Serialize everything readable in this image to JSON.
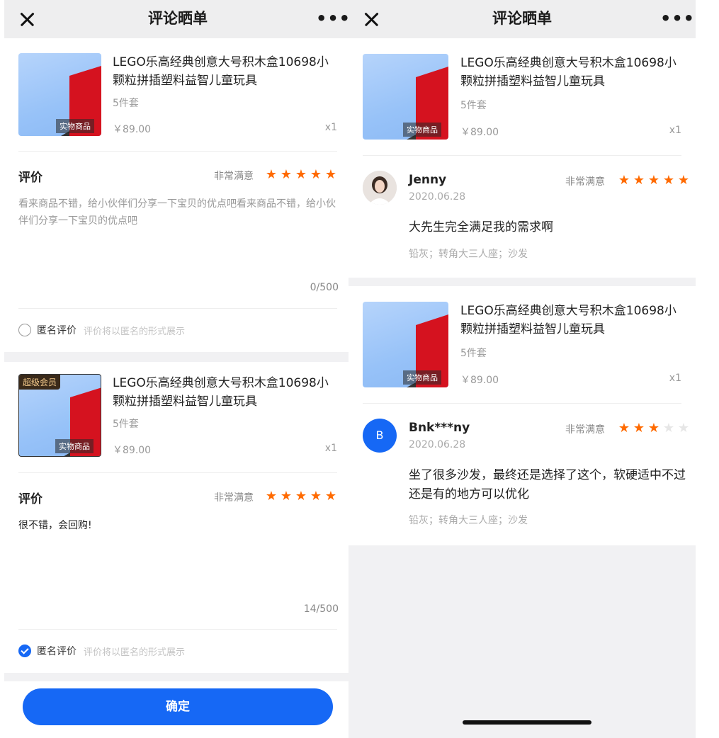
{
  "left": {
    "title": "评论晒单",
    "close_icon": "close-icon",
    "more_icon": "more-icon",
    "more_glyph": "•••",
    "items": [
      {
        "product": {
          "name": "LEGO乐高经典创意大号积木盒10698小颗粒拼插塑料益智儿童玩具",
          "spec": "5件套",
          "price": "￥89.00",
          "qty": "x1",
          "tag": "实物商品"
        },
        "rating_label": "评价",
        "rating_text": "非常满意",
        "stars": 5,
        "review_text": "看来商品不错，给小伙伴们分享一下宝贝的优点吧看来商品不错，给小伙伴们分享一下宝贝的优点吧",
        "counter": "0/500",
        "anon_label": "匿名评价",
        "anon_hint": "评价将以匿名的形式展示",
        "anon_checked": false
      },
      {
        "product": {
          "badge": "超级会员",
          "name": "LEGO乐高经典创意大号积木盒10698小颗粒拼插塑料益智儿童玩具",
          "spec": "5件套",
          "price": "￥89.00",
          "qty": "x1",
          "tag": "实物商品"
        },
        "rating_label": "评价",
        "rating_text": "非常满意",
        "stars": 5,
        "review_text": "很不错，会回购!",
        "counter": "14/500",
        "anon_label": "匿名评价",
        "anon_hint": "评价将以匿名的形式展示",
        "anon_checked": true
      }
    ],
    "confirm_label": "确定",
    "colors": {
      "accent": "#1668f5",
      "star": "#ff6a00"
    }
  },
  "right": {
    "title": "评论晒单",
    "more_glyph": "•••",
    "cards": [
      {
        "product": {
          "name": "LEGO乐高经典创意大号积木盒10698小颗粒拼插塑料益智儿童玩具",
          "spec": "5件套",
          "price": "￥89.00",
          "qty": "x1",
          "tag": "实物商品"
        },
        "review": {
          "avatar": "photo",
          "name": "Jenny",
          "date": "2020.06.28",
          "rating_text": "非常满意",
          "stars": 5,
          "content": "大先生完全满足我的需求啊",
          "spec": "铅灰；转角大三人座；沙发"
        }
      },
      {
        "product": {
          "name": "LEGO乐高经典创意大号积木盒10698小颗粒拼插塑料益智儿童玩具",
          "spec": "5件套",
          "price": "￥89.00",
          "qty": "x1",
          "tag": "实物商品"
        },
        "review": {
          "avatar_letter": "B",
          "name": "Bnk***ny",
          "date": "2020.06.28",
          "rating_text": "非常满意",
          "stars": 3,
          "content": "坐了很多沙发，最终还是选择了这个，软硬适中不过还是有的地方可以优化",
          "spec": "铅灰；转角大三人座；沙发"
        }
      }
    ]
  }
}
